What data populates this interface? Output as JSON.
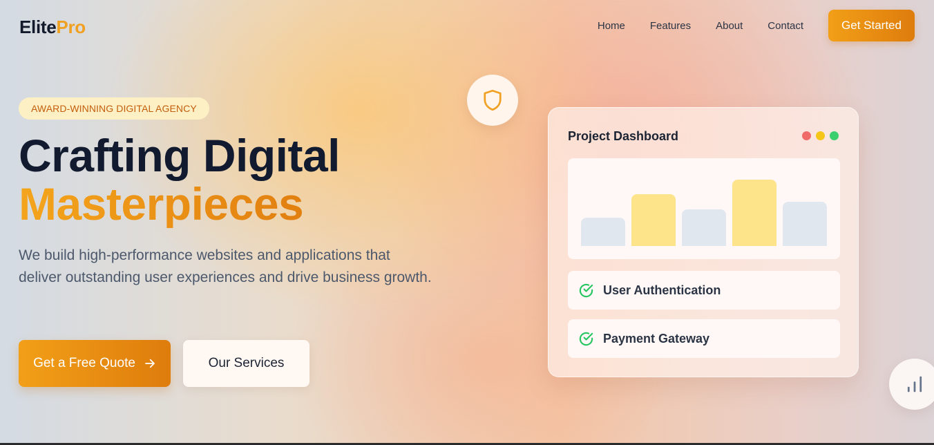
{
  "header": {
    "logo_main": "Elite",
    "logo_accent": "Pro",
    "nav": [
      "Home",
      "Features",
      "About",
      "Contact"
    ],
    "cta_label": "Get Started"
  },
  "hero": {
    "badge": "AWARD-WINNING DIGITAL AGENCY",
    "title_line1": "Crafting Digital",
    "title_line2": "Masterpieces",
    "description": "We build high-performance websites and applications that deliver outstanding user experiences and drive business growth.",
    "primary_button": "Get a Free Quote",
    "secondary_button": "Our Services"
  },
  "dashboard": {
    "title": "Project Dashboard",
    "window_dots": [
      "#f06a6a",
      "#f5c518",
      "#3ccf6e"
    ],
    "bars": [
      {
        "level": 0.37,
        "color": "#e1e7ef"
      },
      {
        "level": 0.67,
        "color": "#fde38a"
      },
      {
        "level": 0.47,
        "color": "#e1e7ef"
      },
      {
        "level": 0.86,
        "color": "#fde38a"
      },
      {
        "level": 0.57,
        "color": "#e1e7ef"
      }
    ],
    "tasks": [
      {
        "label": "User Authentication",
        "icon": "check-circle-icon"
      },
      {
        "label": "Payment Gateway",
        "icon": "check-circle-icon"
      }
    ]
  },
  "colors": {
    "accent": "#f0a022",
    "success": "#22c55e",
    "dark": "#111a2e"
  },
  "icons": {
    "shield": "shield-icon",
    "chart": "bar-chart-icon",
    "arrow": "arrow-right-icon"
  }
}
